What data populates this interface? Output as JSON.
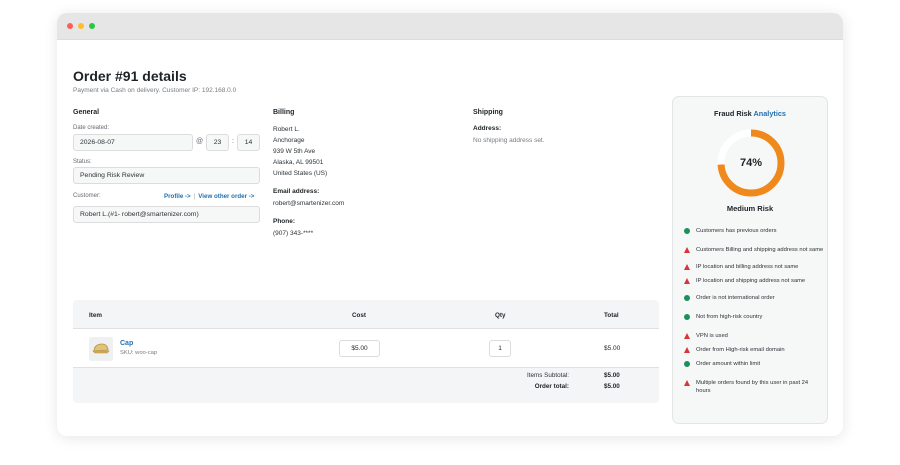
{
  "window": {
    "traffic_lights": [
      "#ff5f57",
      "#febc2e",
      "#28c840"
    ]
  },
  "order": {
    "title": "Order #91 details",
    "subtitle": "Payment via Cash on delivery. Customer IP: 192.168.0.0"
  },
  "general": {
    "heading": "General",
    "date_label": "Date created:",
    "date_value": "2026-08-07",
    "at": "@",
    "hour": "23",
    "colon": ":",
    "minute": "14",
    "status_label": "Status:",
    "status_value": "Pending Risk Review",
    "customer_label": "Customer:",
    "profile_link": "Profile ->",
    "link_sep": "|",
    "other_orders_link": "View other order ->",
    "customer_value": "Robert L.(#1- robert@smartenizer.com)"
  },
  "billing": {
    "heading": "Billing",
    "address_lines": [
      "Robert L.",
      "Anchorage",
      "939 W 5th Ave",
      "Alaska, AL 99501",
      "United States (US)"
    ],
    "email_label": "Email address:",
    "email": "robert@smartenizer.com",
    "phone_label": "Phone:",
    "phone": "(907) 343-****"
  },
  "shipping": {
    "heading": "Shipping",
    "address_label": "Address:",
    "address_value": "No shipping address set."
  },
  "items": {
    "columns": {
      "item": "Item",
      "cost": "Cost",
      "qty": "Qty",
      "total": "Total"
    },
    "rows": [
      {
        "name": "Cap",
        "sku": "SKU: woo-cap",
        "cost": "$5.00",
        "qty": "1",
        "total": "$5.00",
        "thumb_icon": "cap-icon"
      }
    ],
    "subtotal_label": "Items Subtotal:",
    "subtotal_value": "$5.00",
    "order_total_label": "Order total:",
    "order_total_value": "$5.00"
  },
  "fraud": {
    "title": "Fraud Risk",
    "title_accent": "Analytics",
    "percent": "74%",
    "percent_value": 74,
    "gauge_color": "#f0891c",
    "level": "Medium Risk",
    "factors": [
      {
        "text": "Customers has previous orders",
        "type": "good"
      },
      {
        "text": "Customers Billing and shipping address not same",
        "type": "warn"
      },
      {
        "text": "IP location and billing address not same",
        "type": "warn"
      },
      {
        "text": "IP location and shipping address not same",
        "type": "warn"
      },
      {
        "text": "Order is not international order",
        "type": "good"
      },
      {
        "text": "Not from high-risk country",
        "type": "good"
      },
      {
        "text": "VPN is used",
        "type": "warn"
      },
      {
        "text": "Order from High-risk email domain",
        "type": "warn"
      },
      {
        "text": "Order amount within limit",
        "type": "good"
      },
      {
        "text": "Multiple orders found by this user in past 24 hours",
        "type": "warn"
      }
    ]
  }
}
